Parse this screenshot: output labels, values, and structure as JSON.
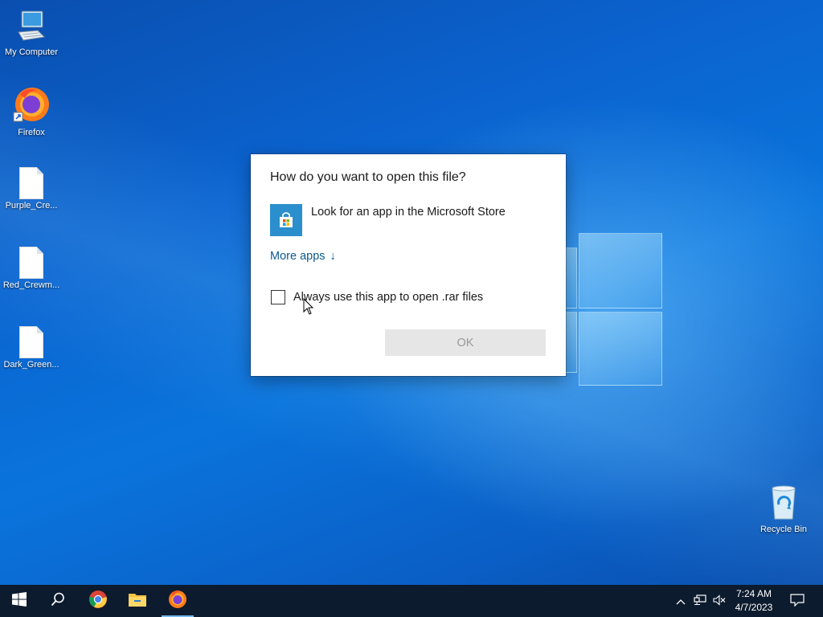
{
  "desktop": {
    "icons": [
      {
        "label": "My Computer"
      },
      {
        "label": "Firefox"
      },
      {
        "label": "Purple_Cre..."
      },
      {
        "label": "Red_Crewm..."
      },
      {
        "label": "Dark_Green..."
      },
      {
        "label": "Recycle Bin"
      }
    ]
  },
  "dialog": {
    "title": "How do you want to open this file?",
    "store_option": "Look for an app in the Microsoft Store",
    "more_apps": "More apps",
    "more_apps_arrow": "↓",
    "always_use_label": "Always use this app to open .rar files",
    "always_use_checked": false,
    "ok_label": "OK"
  },
  "taskbar": {
    "pinned": [
      "start-icon",
      "search-icon",
      "chrome-icon",
      "file-explorer-icon",
      "firefox-icon"
    ],
    "active": "firefox-icon",
    "clock_time": "7:24 AM",
    "clock_date": "4/7/2023",
    "tray": [
      "chevron-up-icon",
      "network-icon",
      "volume-muted-icon",
      "notification-icon"
    ]
  }
}
